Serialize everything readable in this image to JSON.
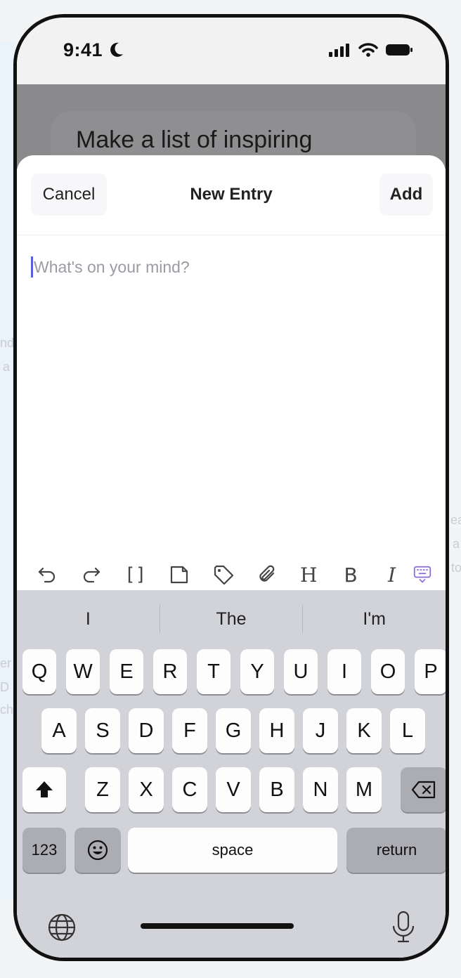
{
  "status_bar": {
    "time": "9:41"
  },
  "background_card_text": "Make a list of inspiring",
  "background_side_text": [
    "nd",
    "a",
    "ea",
    "a",
    "to",
    "er",
    "D",
    "ch"
  ],
  "nav": {
    "cancel_label": "Cancel",
    "title": "New Entry",
    "add_label": "Add"
  },
  "editor": {
    "placeholder": "What's on your mind?",
    "value": ""
  },
  "toolbar": {
    "tools": [
      "undo-icon",
      "redo-icon",
      "brackets-icon",
      "note-icon",
      "tag-icon",
      "attachment-icon",
      "heading-icon",
      "bold-icon",
      "italic-icon",
      "keyboard-dismiss-icon"
    ],
    "heading_label": "H",
    "bold_label": "B",
    "italic_label": "I",
    "brackets_label": "[]"
  },
  "keyboard": {
    "suggestions": [
      "I",
      "The",
      "I'm"
    ],
    "row1": [
      "Q",
      "W",
      "E",
      "R",
      "T",
      "Y",
      "U",
      "I",
      "O",
      "P"
    ],
    "row2": [
      "A",
      "S",
      "D",
      "F",
      "G",
      "H",
      "J",
      "K",
      "L"
    ],
    "row3": [
      "Z",
      "X",
      "C",
      "V",
      "B",
      "N",
      "M"
    ],
    "numbers_label": "123",
    "space_label": "space",
    "return_label": "return"
  },
  "colors": {
    "caret": "#5a5ee0",
    "keyboard_bg": "#d2d3d8"
  }
}
